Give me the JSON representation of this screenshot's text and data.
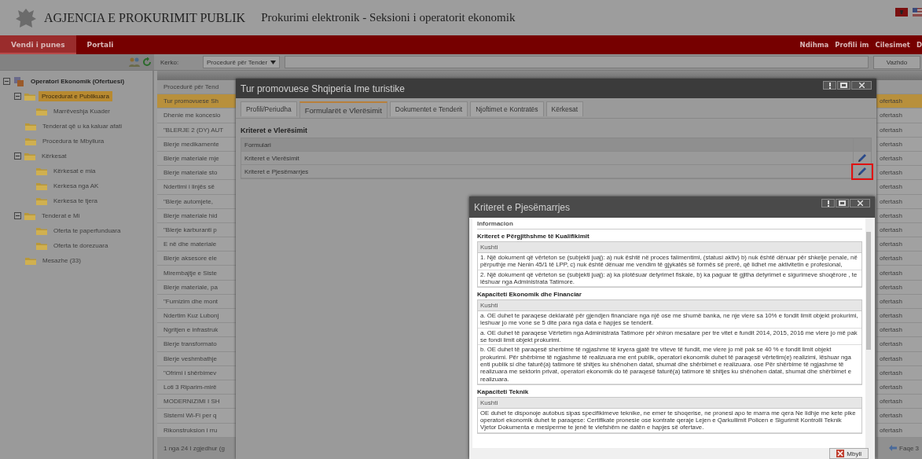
{
  "header": {
    "agency": "AGJENCIA E PROKURIMIT PUBLIK",
    "subtitle": "Prokurimi elektronik - Seksioni i operatorit ekonomik"
  },
  "nav": {
    "tabs": [
      {
        "label": "Vendi i punes",
        "selected": true
      },
      {
        "label": "Portali",
        "selected": false
      }
    ],
    "links": [
      "Ndihma",
      "Profili im",
      "Cilesimet",
      "D"
    ]
  },
  "search": {
    "label": "Kerko:",
    "select": "Procedurë për Tender",
    "button": "Vazhdo"
  },
  "sidebar": {
    "items": [
      {
        "label": "Operatori Ekonomik (Ofertuesi)",
        "kind": "root",
        "expanded": true,
        "selected": false,
        "children": [
          {
            "label": "Procedurat e Publikuara",
            "kind": "folder",
            "expanded": true,
            "selected": true,
            "children": [
              {
                "label": "Marrëveshja Kuader",
                "kind": "folder",
                "selected": false
              }
            ]
          },
          {
            "label": "Tenderat që u ka kaluar afati",
            "kind": "folder",
            "selected": false
          },
          {
            "label": "Procedura te Mbyllura",
            "kind": "folder",
            "selected": false
          },
          {
            "label": "Kërkesat",
            "kind": "folder",
            "expanded": true,
            "selected": false,
            "children": [
              {
                "label": "Kërkesat e mia",
                "kind": "folder",
                "selected": false
              },
              {
                "label": "Kerkesa nga AK",
                "kind": "folder",
                "selected": false
              },
              {
                "label": "Kerkesa te tjera",
                "kind": "folder",
                "selected": false
              }
            ]
          },
          {
            "label": "Tenderat e Mi",
            "kind": "folder",
            "expanded": true,
            "selected": false,
            "children": [
              {
                "label": "Oferta te paperfunduara",
                "kind": "folder",
                "selected": false
              },
              {
                "label": "Oferta te dorezuara",
                "kind": "folder",
                "selected": false
              }
            ]
          },
          {
            "label": "Mesazhe (33)",
            "kind": "folder",
            "selected": false
          }
        ]
      }
    ]
  },
  "table": {
    "filter": "Procedurë për Tend",
    "rows": [
      {
        "title": "Tur promovuese Sh",
        "column_2": "ofertash",
        "selected": true
      },
      {
        "title": "Dhenie me koncesio",
        "column_2": "ofertash",
        "selected": false
      },
      {
        "title": "\"BLERJE 2 (DY) AUT",
        "column_2": "ofertash",
        "selected": false
      },
      {
        "title": "Blerje medikamente",
        "column_2": "ofertash",
        "selected": false
      },
      {
        "title": "Blerje materiale mje",
        "column_2": "ofertash",
        "selected": false
      },
      {
        "title": "Blerje materiale sto",
        "column_2": "ofertash",
        "selected": false
      },
      {
        "title": "Ndertimi i linjës së",
        "column_2": "ofertash",
        "selected": false
      },
      {
        "title": "\"Blerje automjete,",
        "column_2": "ofertash",
        "selected": false
      },
      {
        "title": "Blerje materiale hid",
        "column_2": "ofertash",
        "selected": false
      },
      {
        "title": "\"Blerje karburanti p",
        "column_2": "ofertash",
        "selected": false
      },
      {
        "title": "E në dhe materiale",
        "column_2": "ofertash",
        "selected": false
      },
      {
        "title": "Blerje aksesore ele",
        "column_2": "ofertash",
        "selected": false
      },
      {
        "title": "Mirembajtje e Siste",
        "column_2": "ofertash",
        "selected": false
      },
      {
        "title": "Blerje materiale, pa",
        "column_2": "ofertash",
        "selected": false
      },
      {
        "title": "\"Furnizim dhe mont",
        "column_2": "ofertash",
        "selected": false
      },
      {
        "title": "Ndertim Kuz Lubonj",
        "column_2": "ofertash",
        "selected": false
      },
      {
        "title": "Ngritjen e infrastruk",
        "column_2": "ofertash",
        "selected": false
      },
      {
        "title": "Blerje transformato",
        "column_2": "ofertash",
        "selected": false
      },
      {
        "title": "Blerje veshmbathje",
        "column_2": "ofertash",
        "selected": false
      },
      {
        "title": "\"Ofrimi i shërbimev",
        "column_2": "ofertash",
        "selected": false
      },
      {
        "title": "Loti 3 Riparim-mirë",
        "column_2": "ofertash",
        "selected": false
      },
      {
        "title": "MODERNIZIMI I SH",
        "column_2": "ofertash",
        "selected": false
      },
      {
        "title": "Sistemi Wi-Fi per q",
        "column_2": "ofertash",
        "selected": false
      },
      {
        "title": "Rikonstruksion i rru",
        "column_2": "ofertash",
        "selected": false
      }
    ],
    "footer": "1 nga 24 I zgjedhur (g",
    "pager": "Faqe 3"
  },
  "tender_window": {
    "title": "Tur promovuese Shqiperia Ime turistike",
    "tabs": [
      {
        "label": "Profili/Periudha",
        "selected": false
      },
      {
        "label": "Formularët e Vlerësimit",
        "selected": true
      },
      {
        "label": "Dokumentet e Tenderit",
        "selected": false
      },
      {
        "label": "Njoftimet e Kontratës",
        "selected": false
      },
      {
        "label": "Kërkesat",
        "selected": false
      }
    ],
    "heading": "Kriteret e Vlerësimit",
    "column": "Formulari",
    "rows": [
      {
        "label": "Kriteret e Vlerësimit",
        "highlighted": false
      },
      {
        "label": "Kriteret e Pjesëmarrjes",
        "highlighted": true
      }
    ]
  },
  "criteria_window": {
    "title": "Kriteret e Pjesëmarrjes",
    "legend": "Informacion",
    "sections": [
      {
        "heading": "Kriteret e Përgjithshme të Kualifikimit",
        "column": "Kushti",
        "rows": [
          "1. Një dokument që vërteton se (subjekti juaj): a) nuk është në proces falimentimi, (statusi aktiv) b) nuk është dënuar për shkelje penale, në përputhje me Nenin 45/1 të LPP, c) nuk është dënuar me vendim të gjykatës së formës së prerë, që lidhet me aktivitetin e profesional,",
          "2. Një dokument që vërteton se (subjekti juaj): a) ka plotësuar detyrimet fiskale, b) ka paguar të gjitha detyrimet e sigurimeve shoqërore , te lëshuar nga Administrata Tatimore."
        ]
      },
      {
        "heading": "Kapaciteti Ekonomik dhe Financiar",
        "column": "Kushti",
        "rows": [
          "a. OE duhet te paraqese deklaratë për gjendjen financiare nga një ose me shumë banka, ne nje vlere sa 10% e fondit limit objekt prokurimi, leshuar jo me vone se 5 dite para nga data e hapjes se tenderit.",
          "a. OE duhet të paraqese Vërtetim nga Administrata Tatimore për xhiron mesatare per tre vitet e fundit 2014, 2015, 2016 me vlere jo më pak se fondi limit objekt prokurimi.",
          "b. OE duhet të paraqesë sherbime të ngjashme të kryera gjatë tre viteve të fundit, me vlere jo më pak se 40 % e fondit limit objekt prokurimi. Për shërbime të ngjashme të realizuara me ent publik, operatori ekonomik duhet të paraqesë vërtetim(e) realizimi, lëshuar nga enti publik si dhe faturë(a) tatimore të shitjes ku shënohen datat, shumat dhe shërbimet e realizuara. ose Për shërbime të ngjashme të realizuara me sektorin privat, operatori ekonomik do të paraqesë faturë(a) tatimore të shitjes ku shënohen datat, shumat dhe shërbimet e realizuara."
        ]
      },
      {
        "heading": "Kapaciteti Teknik",
        "column": "Kushti",
        "rows": [
          "OE duhet te disponoje autobus sipas specifikimeve teknike, ne emer te shoqerise, ne pronesi apo te marra me qera Ne lidhje me kete pike operatori ekonomik duhet te paraqese: Certifikate pronesie ose kontrate qeraje Lejen e Qarkullimit Policen e Sigurimit Kontrolli Teknik Vjetor Dokumenta e mesiperme te jenë te vlefshëm ne datën e hapjes së ofertave."
        ]
      }
    ],
    "button": "Mbyll"
  }
}
